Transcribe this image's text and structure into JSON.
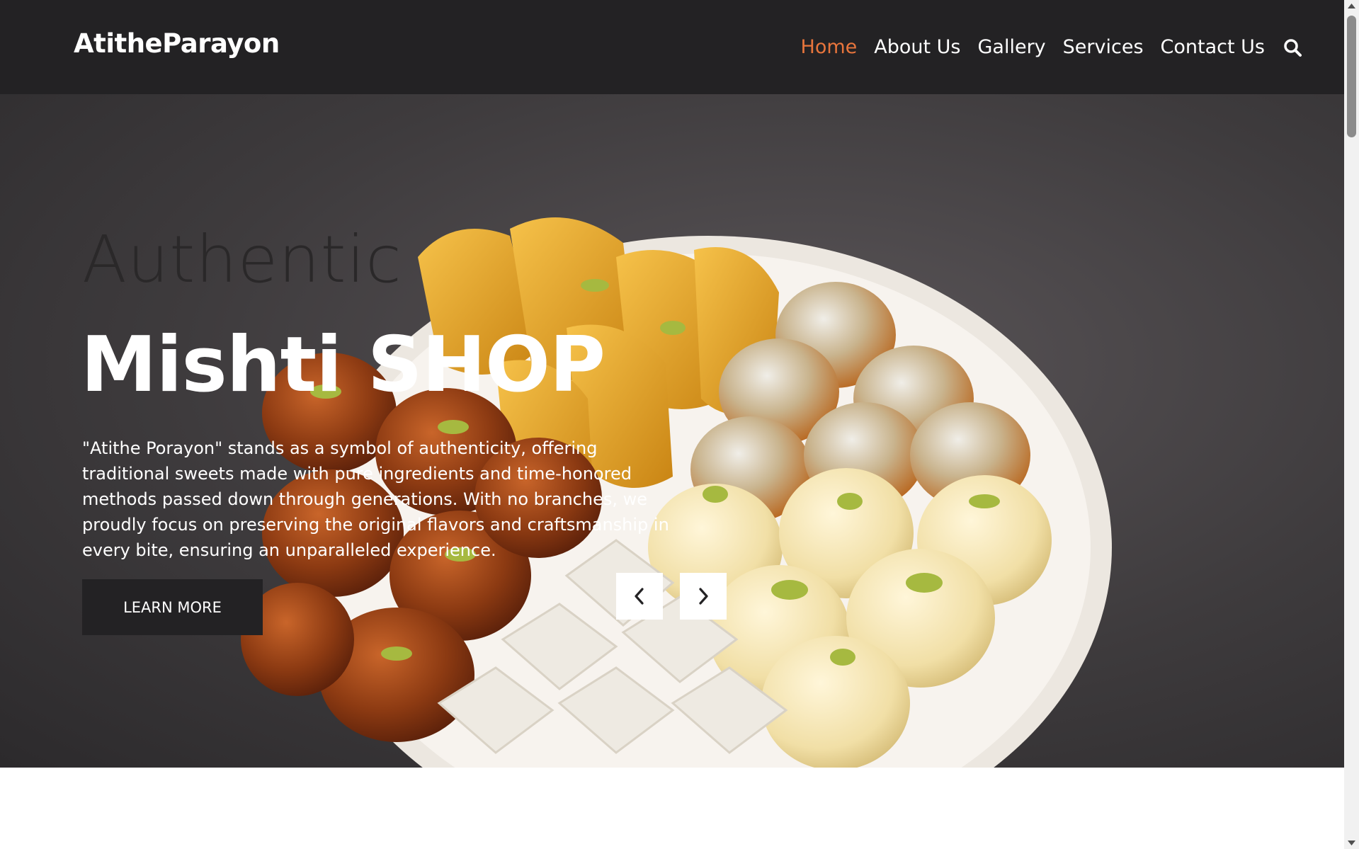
{
  "header": {
    "brand": "AtitheParayon",
    "nav": [
      {
        "label": "Home",
        "active": true
      },
      {
        "label": "About Us",
        "active": false
      },
      {
        "label": "Gallery",
        "active": false
      },
      {
        "label": "Services",
        "active": false
      },
      {
        "label": "Contact Us",
        "active": false
      }
    ],
    "search_icon": "search-icon"
  },
  "hero": {
    "subtitle": "Authentic",
    "title": "Mishti SHOP",
    "description": "\"Atithe Porayon\" stands as a symbol of authenticity, offering traditional sweets made with pure ingredients and time-honored methods passed down through generations. With no branches, we proudly focus on preserving the original flavors and craftsmanship in every bite, ensuring an unparalleled experience.",
    "button_label": "LEARN MORE",
    "prev_icon": "chevron-left-icon",
    "next_icon": "chevron-right-icon"
  },
  "colors": {
    "header_bg": "#232224",
    "accent": "#e8753c",
    "button_bg": "#232224"
  }
}
